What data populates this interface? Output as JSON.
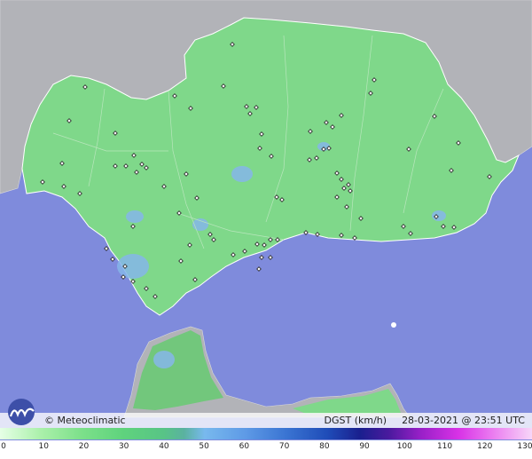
{
  "credit": "© Meteoclimatic",
  "product": {
    "variable": "DGST (km/h)",
    "timestamp": "28-03-2021 @ 23:51 UTC"
  },
  "colors": {
    "sea": "#7f8bdc",
    "land_outside": "#b4b4b8",
    "land_region": "#7fd88a",
    "high_wind": "#7fb0e8"
  },
  "icons": {
    "logo": "meteoclimatic-logo",
    "stations": "station-marker"
  },
  "legend": {
    "ticks": [
      {
        "label": "0",
        "value": 0
      },
      {
        "label": "10",
        "value": 10
      },
      {
        "label": "20",
        "value": 20
      },
      {
        "label": "30",
        "value": 30
      },
      {
        "label": "40",
        "value": 40
      },
      {
        "label": "50",
        "value": 50
      },
      {
        "label": "60",
        "value": 60
      },
      {
        "label": "70",
        "value": 70
      },
      {
        "label": "80",
        "value": 80
      },
      {
        "label": "90",
        "value": 90
      },
      {
        "label": "100",
        "value": 100
      },
      {
        "label": "110",
        "value": 110
      },
      {
        "label": "120",
        "value": 120
      },
      {
        "label": "130",
        "value": 130
      }
    ],
    "color_stops": [
      {
        "value": 0,
        "color": "#e6ffe6"
      },
      {
        "value": 10,
        "color": "#aaf0aa"
      },
      {
        "value": 20,
        "color": "#7ce08a"
      },
      {
        "value": 30,
        "color": "#5fd37d"
      },
      {
        "value": 40,
        "color": "#58c486"
      },
      {
        "value": 45,
        "color": "#5ab2a0"
      },
      {
        "value": 50,
        "color": "#78b9ee"
      },
      {
        "value": 60,
        "color": "#5e9ae6"
      },
      {
        "value": 70,
        "color": "#3a74d2"
      },
      {
        "value": 80,
        "color": "#1f4cb8"
      },
      {
        "value": 88,
        "color": "#1a1f8e"
      },
      {
        "value": 95,
        "color": "#4a1a9e"
      },
      {
        "value": 103,
        "color": "#9a20c8"
      },
      {
        "value": 112,
        "color": "#d832e6"
      },
      {
        "value": 120,
        "color": "#ea78f0"
      },
      {
        "value": 130,
        "color": "#f7d6f8"
      }
    ]
  }
}
